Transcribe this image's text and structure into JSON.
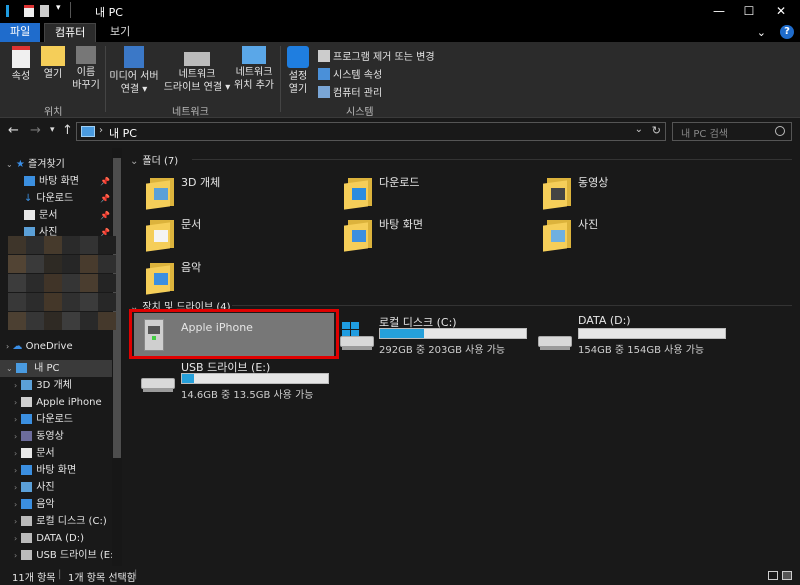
{
  "window": {
    "title": "내 PC"
  },
  "ribbon_tabs": {
    "file": "파일",
    "computer": "컴퓨터",
    "view": "보기"
  },
  "ribbon": {
    "location": {
      "label": "위치",
      "properties": "속성",
      "open": "열기",
      "rename_l1": "이름",
      "rename_l2": "바꾸기"
    },
    "network": {
      "label": "네트워크",
      "media_l1": "미디어 서버",
      "media_l2": "연결 ▾",
      "map_l1": "네트워크",
      "map_l2": "드라이브 연결 ▾",
      "add_l1": "네트워크",
      "add_l2": "위치 추가"
    },
    "system": {
      "label": "시스템",
      "settings_l1": "설정",
      "settings_l2": "열기",
      "uninstall": "프로그램 제거 또는 변경",
      "sysprops": "시스템 속성",
      "manage": "컴퓨터 관리"
    }
  },
  "address": {
    "path": "내 PC",
    "search_placeholder": "내 PC 검색"
  },
  "nav": {
    "quick_access": "즐겨찾기",
    "quick_items": [
      "바탕 화면",
      "다운로드",
      "문서",
      "사진"
    ],
    "onedrive": "OneDrive",
    "this_pc": "내 PC",
    "pc_items": [
      "3D 개체",
      "Apple iPhone",
      "다운로드",
      "동영상",
      "문서",
      "바탕 화면",
      "사진",
      "음악",
      "로컬 디스크 (C:)",
      "DATA (D:)",
      "USB 드라이브 (E:"
    ]
  },
  "folders": {
    "header": "폴더 (7)",
    "items": [
      "3D 개체",
      "다운로드",
      "동영상",
      "문서",
      "바탕 화면",
      "사진",
      "음악"
    ]
  },
  "devices": {
    "header": "장치 및 드라이브 (4)",
    "iphone": "Apple iPhone",
    "c": {
      "name": "로컬 디스크 (C:)",
      "info": "292GB 중 203GB 사용 가능",
      "used_fraction": 0.3
    },
    "d": {
      "name": "DATA (D:)",
      "info": "154GB 중 154GB 사용 가능",
      "used_fraction": 0.0
    },
    "e": {
      "name": "USB 드라이브 (E:)",
      "info": "14.6GB 중 13.5GB 사용 가능",
      "used_fraction": 0.08
    }
  },
  "status": {
    "count": "11개 항목",
    "selected": "1개 항목 선택함"
  }
}
